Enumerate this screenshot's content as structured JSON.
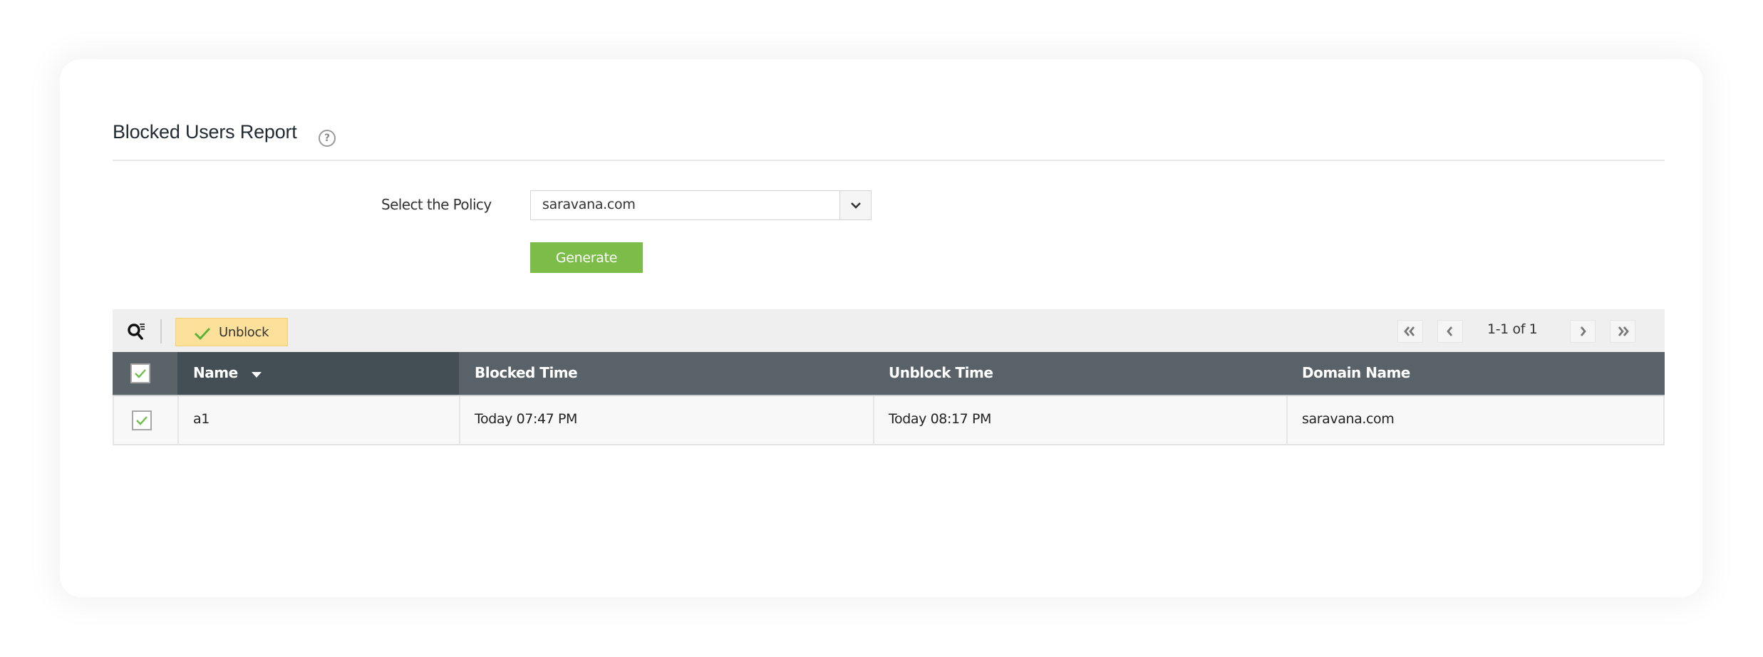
{
  "page": {
    "title": "Blocked Users Report",
    "help_icon": "question-circle-icon"
  },
  "form": {
    "policy_label": "Select the Policy",
    "policy_value": "saravana.com",
    "generate_label": "Generate"
  },
  "toolbar": {
    "search_icon": "search-filter-icon",
    "unblock_label": "Unblock",
    "unblock_icon": "check-icon"
  },
  "pagination": {
    "first_icon": "double-chevron-left-icon",
    "prev_icon": "chevron-left-icon",
    "range_text": "1-1 of 1",
    "next_icon": "chevron-right-icon",
    "last_icon": "double-chevron-right-icon"
  },
  "table": {
    "select_all_checked": true,
    "sorted_column": "Name",
    "sort_direction": "descending",
    "columns": [
      "Name",
      "Blocked Time",
      "Unblock Time",
      "Domain Name"
    ],
    "rows": [
      {
        "checked": true,
        "name": "a1",
        "blocked_time": "Today 07:47 PM",
        "unblock_time": "Today 08:17 PM",
        "domain_name": "saravana.com"
      }
    ]
  },
  "colors": {
    "accent_green": "#7cbd4a",
    "unblock_yellow": "#fde19a",
    "header_bg": "#586268",
    "header_sorted_bg": "#434e55",
    "check_green": "#6cc04a"
  }
}
